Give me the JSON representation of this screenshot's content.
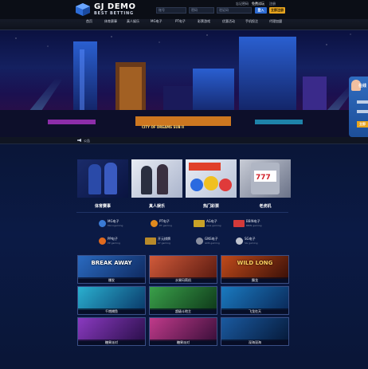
{
  "header": {
    "logo_title": "GJ DEMO",
    "logo_sub": "BEST BETTING",
    "username_placeholder": "账号",
    "password_placeholder": "密码",
    "captcha_placeholder": "验证码",
    "forgot_label": "忘记密码",
    "free_trial_label": "免费试玩",
    "register_hint": "注册",
    "login_button": "登入",
    "register_button": "立即注册"
  },
  "nav": {
    "items": [
      "首页",
      "体育赛事",
      "真人娱乐",
      "MG电子",
      "PT电子",
      "彩票游戏",
      "优惠活动",
      "手机投注",
      "代理加盟"
    ]
  },
  "banner": {
    "sign_text": "CITY OF DREAMS SUB II",
    "chat_label_1": "在线",
    "chat_label_2": "立即"
  },
  "ticker": {
    "text": "公告"
  },
  "categories": [
    {
      "label": "体育赛事"
    },
    {
      "label": "真人娱乐"
    },
    {
      "label": "热门彩票"
    },
    {
      "label": "老虎机"
    }
  ],
  "providers": [
    {
      "name": "MG电子",
      "sub": "Microgaming",
      "color": "#3a7bd5"
    },
    {
      "name": "PT电子",
      "sub": "PT gaming",
      "color": "#e08a1e"
    },
    {
      "name": "AG电子",
      "sub": "Asia gaming",
      "color": "#c9a227"
    },
    {
      "name": "BBIN电子",
      "sub": "BBIN gaming",
      "color": "#d33a3a"
    },
    {
      "name": "PP电子",
      "sub": "PP gaming",
      "color": "#e06a1e"
    },
    {
      "name": "开元棋牌",
      "sub": "KY gaming",
      "color": "#b88a2a"
    },
    {
      "name": "GNS电子",
      "sub": "GNS gaming",
      "color": "#8a8fa0"
    },
    {
      "name": "SG电子",
      "sub": "SG gaming",
      "color": "#c0c4cf"
    }
  ],
  "games": [
    {
      "label": "爆发",
      "title": "BREAK AWAY",
      "color": "#1d4d8f"
    },
    {
      "label": "水果玛莉机",
      "title": "",
      "color": "#a03a2a"
    },
    {
      "label": "舞龙",
      "title": "WILD LONG",
      "color": "#7a2a18"
    },
    {
      "label": "千炮捕鱼",
      "title": "",
      "color": "#1b6a8a"
    },
    {
      "label": "超级斗地主",
      "title": "",
      "color": "#2a7a3a"
    },
    {
      "label": "飞龙在天",
      "title": "",
      "color": "#16548a"
    },
    {
      "label": "糖果派对",
      "title": "",
      "color": "#4a2a7a"
    },
    {
      "label": "糖果派对",
      "title": "",
      "color": "#5a2a6a"
    },
    {
      "label": "深海深海",
      "title": "",
      "color": "#113a6a"
    }
  ]
}
